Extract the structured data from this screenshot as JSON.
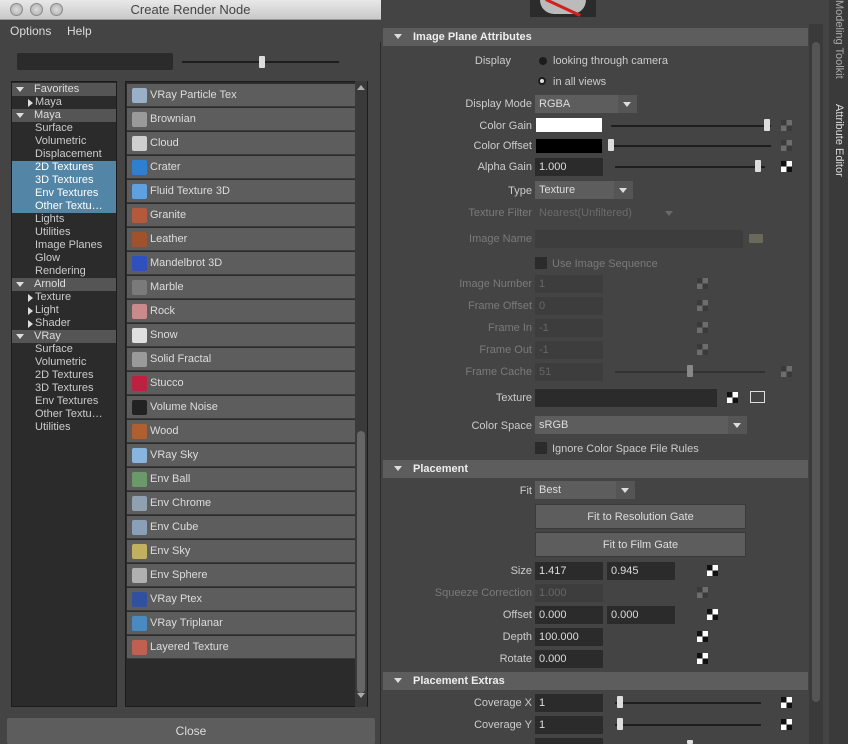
{
  "window": {
    "title": "Create Render Node"
  },
  "menu": {
    "options": "Options",
    "help": "Help"
  },
  "tree": [
    {
      "label": "Favorites",
      "kind": "head",
      "exp": "down"
    },
    {
      "label": "Maya",
      "kind": "child",
      "exp": "right"
    },
    {
      "label": "Maya",
      "kind": "head",
      "exp": "down"
    },
    {
      "label": "Surface",
      "kind": "leaf"
    },
    {
      "label": "Volumetric",
      "kind": "leaf"
    },
    {
      "label": "Displacement",
      "kind": "leaf"
    },
    {
      "label": "2D Textures",
      "kind": "leaf",
      "sel": true
    },
    {
      "label": "3D Textures",
      "kind": "leaf",
      "sel": true
    },
    {
      "label": "Env Textures",
      "kind": "leaf",
      "sel": true
    },
    {
      "label": "Other Textu…",
      "kind": "leaf",
      "sel": true
    },
    {
      "label": "Lights",
      "kind": "leaf"
    },
    {
      "label": "Utilities",
      "kind": "leaf"
    },
    {
      "label": "Image Planes",
      "kind": "leaf"
    },
    {
      "label": "Glow",
      "kind": "leaf"
    },
    {
      "label": "Rendering",
      "kind": "leaf"
    },
    {
      "label": "Arnold",
      "kind": "head",
      "exp": "down"
    },
    {
      "label": "Texture",
      "kind": "child",
      "exp": "right"
    },
    {
      "label": "Light",
      "kind": "child",
      "exp": "right"
    },
    {
      "label": "Shader",
      "kind": "child",
      "exp": "right"
    },
    {
      "label": "VRay",
      "kind": "head",
      "exp": "down"
    },
    {
      "label": "Surface",
      "kind": "leaf"
    },
    {
      "label": "Volumetric",
      "kind": "leaf"
    },
    {
      "label": "2D Textures",
      "kind": "leaf"
    },
    {
      "label": "3D Textures",
      "kind": "leaf"
    },
    {
      "label": "Env Textures",
      "kind": "leaf"
    },
    {
      "label": "Other Textu…",
      "kind": "leaf"
    },
    {
      "label": "Utilities",
      "kind": "leaf"
    }
  ],
  "nodes": [
    {
      "label": "VRay Particle Tex",
      "icon": "vray-particle-tex-icon",
      "color": "#9ab0c8"
    },
    {
      "label": "Brownian",
      "icon": "brownian-icon",
      "color": "#9a9a9a"
    },
    {
      "label": "Cloud",
      "icon": "cloud-icon",
      "color": "#cfcfcf"
    },
    {
      "label": "Crater",
      "icon": "crater-icon",
      "color": "#2f7fd0"
    },
    {
      "label": "Fluid Texture 3D",
      "icon": "fluid-texture-3d-icon",
      "color": "#5fa0e0"
    },
    {
      "label": "Granite",
      "icon": "granite-icon",
      "color": "#b45a3c"
    },
    {
      "label": "Leather",
      "icon": "leather-icon",
      "color": "#a0522d"
    },
    {
      "label": "Mandelbrot 3D",
      "icon": "mandelbrot-3d-icon",
      "color": "#3050c0"
    },
    {
      "label": "Marble",
      "icon": "marble-icon",
      "color": "#7a7a7a"
    },
    {
      "label": "Rock",
      "icon": "rock-icon",
      "color": "#c88a8a"
    },
    {
      "label": "Snow",
      "icon": "snow-icon",
      "color": "#e0e0e0"
    },
    {
      "label": "Solid Fractal",
      "icon": "solid-fractal-icon",
      "color": "#9a9a9a"
    },
    {
      "label": "Stucco",
      "icon": "stucco-icon",
      "color": "#c02040"
    },
    {
      "label": "Volume Noise",
      "icon": "volume-noise-icon",
      "color": "#222222"
    },
    {
      "label": "Wood",
      "icon": "wood-icon",
      "color": "#b06030"
    },
    {
      "label": "VRay Sky",
      "icon": "vray-sky-icon",
      "color": "#8ab4e0"
    },
    {
      "label": "Env Ball",
      "icon": "env-ball-icon",
      "color": "#6a9a6a"
    },
    {
      "label": "Env Chrome",
      "icon": "env-chrome-icon",
      "color": "#90a0b0"
    },
    {
      "label": "Env Cube",
      "icon": "env-cube-icon",
      "color": "#8aa0b8"
    },
    {
      "label": "Env Sky",
      "icon": "env-sky-icon",
      "color": "#c0b060"
    },
    {
      "label": "Env Sphere",
      "icon": "env-sphere-icon",
      "color": "#b0b0b0"
    },
    {
      "label": "VRay Ptex",
      "icon": "vray-ptex-icon",
      "color": "#3050a0"
    },
    {
      "label": "VRay Triplanar",
      "icon": "vray-triplanar-icon",
      "color": "#4a8ac0"
    },
    {
      "label": "Layered Texture",
      "icon": "layered-texture-icon",
      "color": "#c06050"
    }
  ],
  "close_label": "Close",
  "ae": {
    "image_plane_title": "Image Plane Attributes",
    "display_label": "Display",
    "display_opt1": "looking through camera",
    "display_opt2": "in all views",
    "display_mode_label": "Display Mode",
    "display_mode": "RGBA",
    "color_gain_label": "Color Gain",
    "color_offset_label": "Color Offset",
    "alpha_gain_label": "Alpha Gain",
    "alpha_gain": "1.000",
    "type_label": "Type",
    "type": "Texture",
    "texture_filter_label": "Texture Filter",
    "texture_filter": "Nearest(Unfiltered)",
    "image_name_label": "Image Name",
    "use_image_seq": "Use Image Sequence",
    "image_number_label": "Image Number",
    "image_number": "1",
    "frame_offset_label": "Frame Offset",
    "frame_offset": "0",
    "frame_in_label": "Frame In",
    "frame_in": "-1",
    "frame_out_label": "Frame Out",
    "frame_out": "-1",
    "frame_cache_label": "Frame Cache",
    "frame_cache": "51",
    "texture_label": "Texture",
    "color_space_label": "Color Space",
    "color_space": "sRGB",
    "ignore_cs": "Ignore Color Space File Rules",
    "placement_title": "Placement",
    "fit_label": "Fit",
    "fit": "Best",
    "fit_res_gate": "Fit to Resolution Gate",
    "fit_film_gate": "Fit to Film Gate",
    "size_label": "Size",
    "size_x": "1.417",
    "size_y": "0.945",
    "squeeze_label": "Squeeze Correction",
    "squeeze": "1.000",
    "offset_label": "Offset",
    "offset_x": "0.000",
    "offset_y": "0.000",
    "depth_label": "Depth",
    "depth": "100.000",
    "rotate_label": "Rotate",
    "rotate": "0.000",
    "extras_title": "Placement Extras",
    "coverage_x_label": "Coverage X",
    "coverage_x": "1",
    "coverage_y_label": "Coverage Y",
    "coverage_y": "1"
  },
  "side_tabs": {
    "modeling": "Modeling Toolkit",
    "attribute": "Attribute Editor"
  }
}
